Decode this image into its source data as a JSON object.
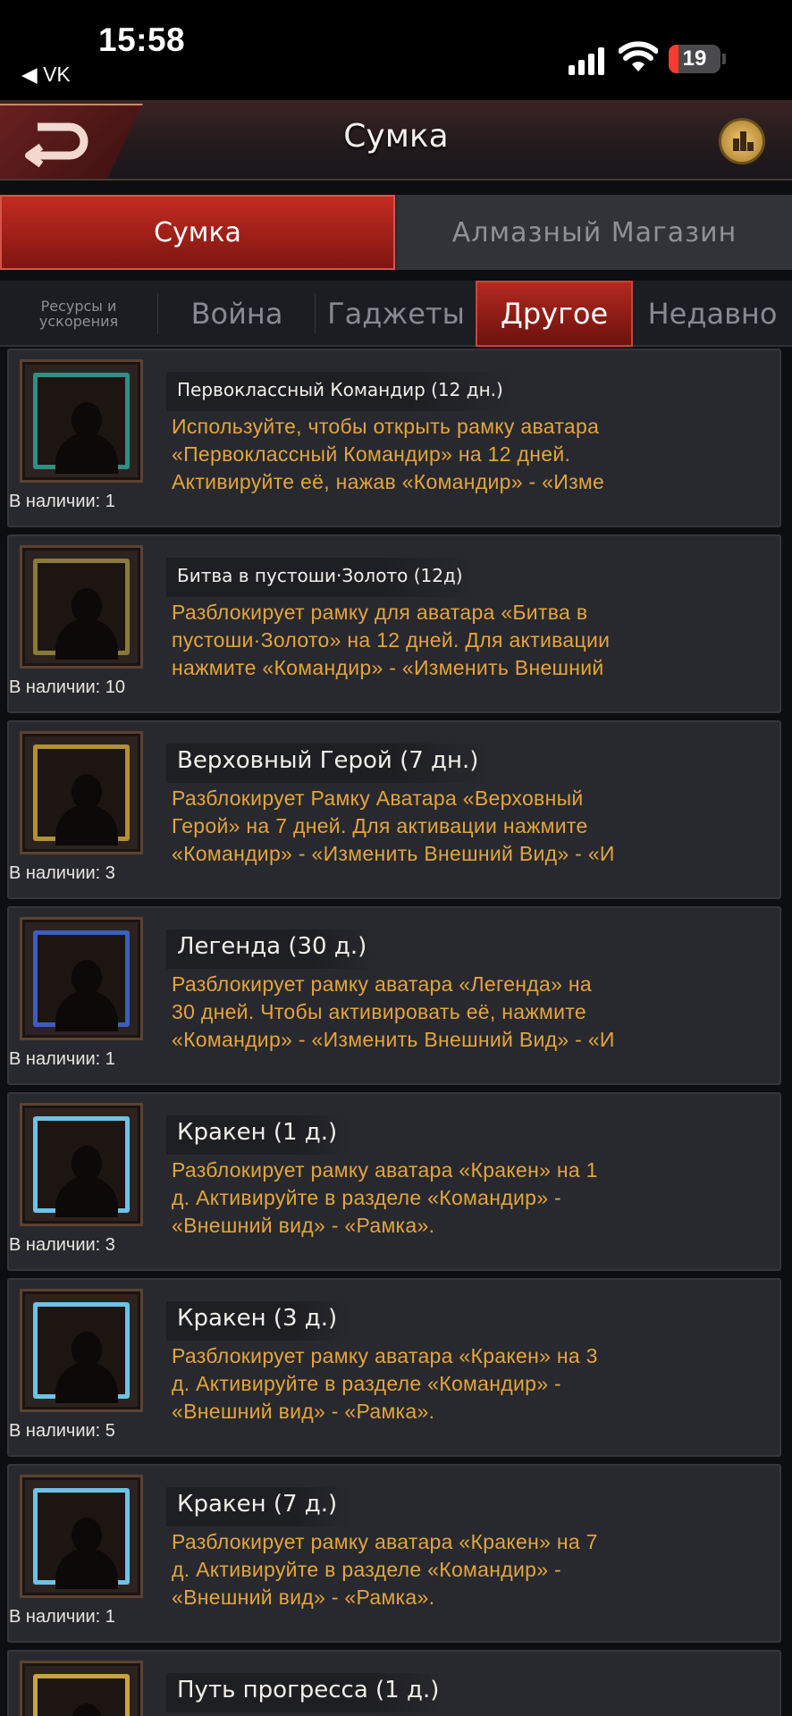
{
  "status_bar": {
    "time": "15:58",
    "back_app": "◀ VK",
    "battery": "19",
    "battery_level": 0.19
  },
  "header": {
    "title": "Сумка"
  },
  "main_tabs": [
    {
      "label": "Сумка"
    },
    {
      "label": "Алмазный Магазин"
    }
  ],
  "sub_tabs": [
    {
      "label": "Ресурсы и\nускорения"
    },
    {
      "label": "Война"
    },
    {
      "label": "Гаджеты"
    },
    {
      "label": "Другое"
    },
    {
      "label": "Недавно"
    }
  ],
  "items": [
    {
      "name": "Первоклассный Командир (12 дн.)",
      "available": "В наличии: 1",
      "frame_color": "#2f8f84",
      "desc": [
        "Используйте, чтобы открыть рамку аватара",
        "«Первоклассный Командир» на 12 дней.",
        "Активируйте её, нажав «Командир» - «Изме"
      ]
    },
    {
      "name": "Битва в пустоши·Золото (12д)",
      "available": "В наличии: 10",
      "frame_color": "#8a7a3a",
      "desc": [
        "Разблокирует рамку для аватара «Битва в",
        "пустоши·Золото» на 12 дней. Для активации",
        "нажмите «Командир» - «Изменить Внешний"
      ]
    },
    {
      "name": "Верховный Герой (7 дн.)",
      "available": "В наличии: 3",
      "frame_color": "#b49034",
      "desc": [
        "Разблокирует Рамку Аватара «Верховный",
        "Герой» на 7 дней. Для активации нажмите",
        "«Командир» - «Изменить Внешний Вид» - «И"
      ]
    },
    {
      "name": "Легенда (30 д.)",
      "available": "В наличии: 1",
      "frame_color": "#3b5fc0",
      "desc": [
        "Разблокирует рамку аватара «Легенда» на",
        "30 дней. Чтобы активировать её, нажмите",
        "«Командир» - «Изменить Внешний Вид» - «И"
      ]
    },
    {
      "name": "Кракен (1 д.)",
      "available": "В наличии: 3",
      "frame_color": "#6ec2e6",
      "desc": [
        "Разблокирует рамку аватара «Кракен» на 1",
        "д. Активируйте в разделе «Командир» -",
        "«Внешний вид» - «Рамка»."
      ]
    },
    {
      "name": "Кракен (3 д.)",
      "available": "В наличии: 5",
      "frame_color": "#6ec2e6",
      "desc": [
        "Разблокирует рамку аватара «Кракен» на 3",
        "д. Активируйте в разделе «Командир» -",
        "«Внешний вид» - «Рамка»."
      ]
    },
    {
      "name": "Кракен (7 д.)",
      "available": "В наличии: 1",
      "frame_color": "#6ec2e6",
      "desc": [
        "Разблокирует рамку аватара «Кракен» на 7",
        "д. Активируйте в разделе «Командир» -",
        "«Внешний вид» - «Рамка»."
      ]
    },
    {
      "name": "Путь прогресса (1 д.)",
      "available": "",
      "frame_color": "#c9a53c",
      "desc": []
    }
  ]
}
